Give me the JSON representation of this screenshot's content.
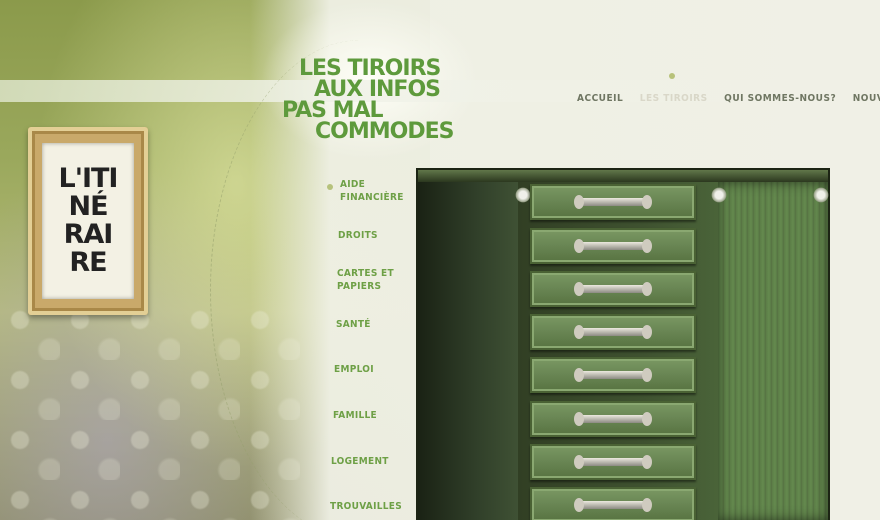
{
  "brand": {
    "sign_lines": [
      "L'ITI",
      "NÉ",
      "RAI",
      "RE"
    ]
  },
  "tagline": {
    "line1": "LES TIROIRS",
    "line2": "AUX INFOS",
    "line3": "PAS MAL",
    "line4": "COMMODES"
  },
  "topnav": {
    "items": [
      {
        "label": "ACCUEIL"
      },
      {
        "label": "LES TIROIRS"
      },
      {
        "label": "QUI SOMMES-NOUS?"
      },
      {
        "label": "NOUVEA"
      }
    ]
  },
  "menu": {
    "items": [
      {
        "label": "AIDE\nFINANCIÈRE"
      },
      {
        "label": "DROITS"
      },
      {
        "label": "CARTES ET\nPAPIERS"
      },
      {
        "label": "SANTÉ"
      },
      {
        "label": "EMPLOI"
      },
      {
        "label": "FAMILLE"
      },
      {
        "label": "LOGEMENT"
      },
      {
        "label": "TROUVAILLES"
      }
    ]
  },
  "colors": {
    "accent_green": "#6ea046",
    "tagline_green": "#5e9a3c",
    "nav_gray": "#6f7662"
  }
}
